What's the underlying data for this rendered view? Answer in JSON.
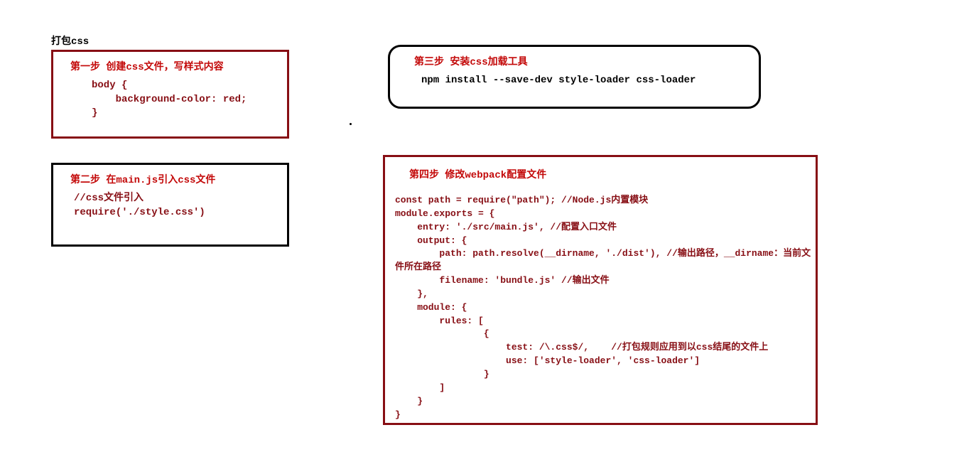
{
  "title": "打包css",
  "step1": {
    "heading": "第一步 创建css文件，写样式内容",
    "code": "body {\n    background-color: red;\n}"
  },
  "step2": {
    "heading": "第二步 在main.js引入css文件",
    "code": "//css文件引入\nrequire('./style.css')"
  },
  "step3": {
    "heading": "第三步 安装css加载工具",
    "code": "npm install --save-dev style-loader css-loader"
  },
  "step4": {
    "heading": "第四步 修改webpack配置文件",
    "code": "const path = require(\"path\"); //Node.js内置模块\nmodule.exports = {\n    entry: './src/main.js', //配置入口文件\n    output: {\n        path: path.resolve(__dirname, './dist'), //输出路径，__dirname：当前文\n件所在路径\n        filename: 'bundle.js' //输出文件\n    },\n    module: {\n        rules: [\n                {\n                    test: /\\.css$/,    //打包规则应用到以css结尾的文件上\n                    use: ['style-loader', 'css-loader']\n                }\n        ]\n    }\n}"
  }
}
